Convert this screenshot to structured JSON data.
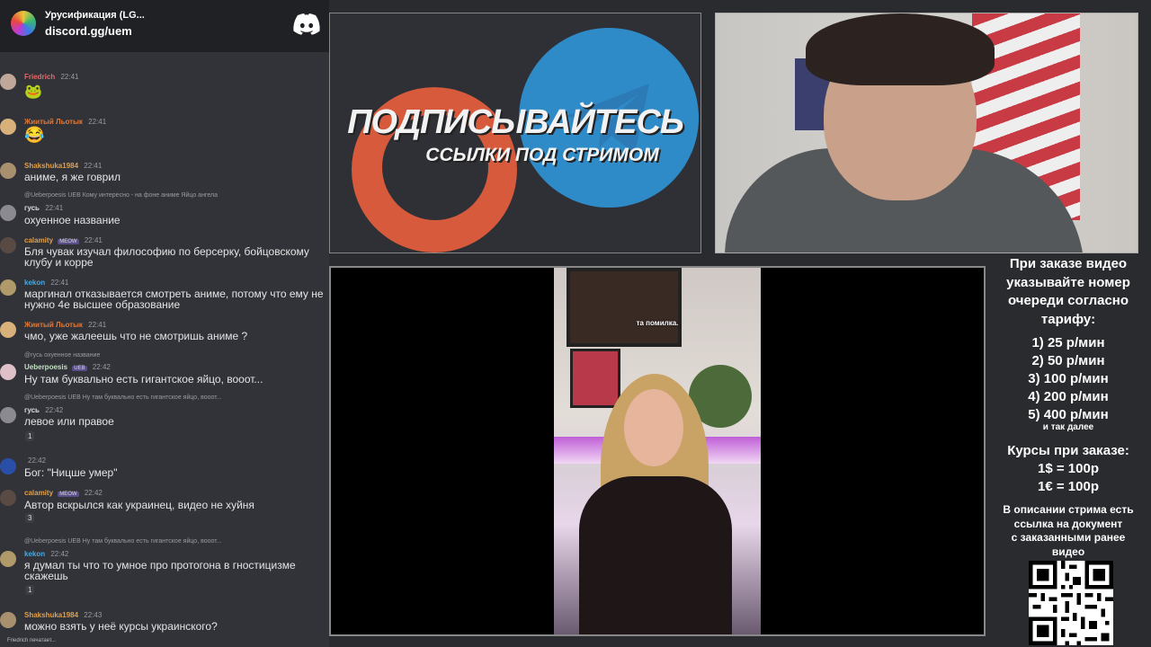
{
  "chat": {
    "server_name": "Урусификация (LG...",
    "server_invite": "discord.gg/uem",
    "typing_indicator": "Friedrich печатает...",
    "messages": [
      {
        "user": "Friedrich",
        "time": "22:41",
        "emoji": "🐸",
        "color": "#e06a6a"
      },
      {
        "user": "Жиитый Льотык",
        "time": "22:41",
        "emoji": "😂",
        "color": "#e0a04a"
      },
      {
        "user": "Shakshuka1984",
        "time": "22:41",
        "text": "аниме, я же говрил",
        "color": "#e0a04a"
      },
      {
        "reply": "@Ueberpoesis  UEB  Кому интересно - на фоне аниме Яйцо ангела",
        "user": "гусь",
        "time": "22:41",
        "text": "охуенное название",
        "color": "#dcdcdc"
      },
      {
        "user": "calamity",
        "tag": "MEOW",
        "time": "22:41",
        "text": "Бля чувак изучал философию по берсерку, бойцовскому клубу и корре",
        "color": "#e0a04a"
      },
      {
        "user": "kekon",
        "time": "22:41",
        "text": "маргинал отказывается смотреть аниме, потому что ему не нужно 4е высшее образование",
        "color": "#4aa8e0"
      },
      {
        "user": "Жиитый Льотык",
        "time": "22:41",
        "text": "чмо, уже жалеешь что не смотришь аниме ?",
        "color": "#e0a04a"
      },
      {
        "reply": "@гусь охуенное название",
        "user": "Ueberpoesis",
        "tag": "UEB",
        "time": "22:42",
        "text": "Ну там буквально есть гигантское яйцо, вооот...",
        "color": "#c0e0c0"
      },
      {
        "reply": "@Ueberpoesis  UEB  Ну там буквально есть гигантское яйцо, вооот...",
        "user": "гусь",
        "time": "22:42",
        "text": "левое или правое",
        "reaction": "1",
        "color": "#dcdcdc"
      },
      {
        "user": "",
        "time": "22:42",
        "text": "Бог: \"Ницше умер\"",
        "color": "#dcdcdc"
      },
      {
        "user": "calamity",
        "tag": "MEOW",
        "time": "22:42",
        "text": "Автор вскрылся как украинец, видео не хуйня",
        "reaction": "3",
        "color": "#e0a04a"
      },
      {
        "reply": "@Ueberpoesis  UEB  Ну там буквально есть гигантское яйцо, вооот...",
        "user": "kekon",
        "time": "22:42",
        "text": "я думал ты что то умное про протогона в гностицизме скажешь",
        "reaction": "1",
        "color": "#4aa8e0"
      },
      {
        "user": "Shakshuka1984",
        "time": "22:43",
        "text": "можно взять у неё курсы украинского?",
        "color": "#e0a04a"
      }
    ]
  },
  "promo": {
    "title": "ПОДПИСЫВАЙТЕСЬ",
    "subtitle": "ССЫЛКИ ПОД СТРИМОМ"
  },
  "video": {
    "caption": "та помилка."
  },
  "info": {
    "order_lines": [
      "При заказе видео",
      "указывайте номер",
      "очереди согласно",
      "тарифу:"
    ],
    "prices": [
      "1) 25 р/мин",
      "2) 50 р/мин",
      "3) 100 р/мин",
      "4) 200 р/мин",
      "5) 400 р/мин"
    ],
    "etc": "и так далее",
    "rates_title": "Курсы при заказе:",
    "rates": [
      "1$ = 100р",
      "1€ = 100р"
    ],
    "desc_lines": [
      "В описании стрима есть",
      "ссылка на документ",
      "с заказанными ранее",
      "видео"
    ]
  }
}
